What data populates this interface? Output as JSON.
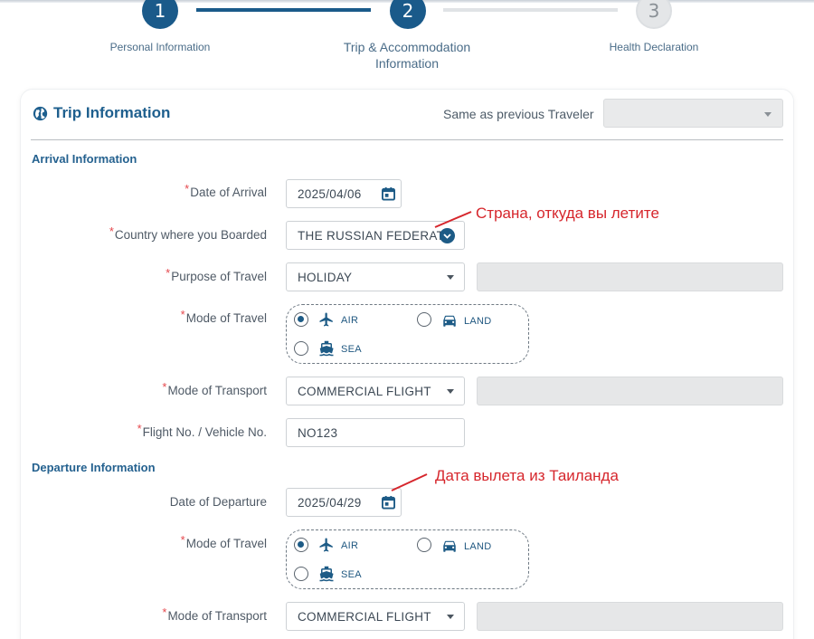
{
  "stepper": {
    "steps": [
      {
        "number": "1",
        "label": "Personal Information",
        "state": "done"
      },
      {
        "number": "2",
        "label": "Trip & Accommodation Information",
        "state": "active"
      },
      {
        "number": "3",
        "label": "Health Declaration",
        "state": "todo"
      }
    ]
  },
  "trip": {
    "title": "Trip Information",
    "same_as_previous_label": "Same as previous Traveler",
    "same_as_previous_value": ""
  },
  "arrival": {
    "section_title": "Arrival Information",
    "date_label": "Date of Arrival",
    "date_value": "2025/04/06",
    "country_label": "Country where you Boarded",
    "country_value": "THE RUSSIAN FEDERAT",
    "purpose_label": "Purpose of Travel",
    "purpose_value": "HOLIDAY",
    "mode_label": "Mode of Travel",
    "mode_options": [
      "AIR",
      "LAND",
      "SEA"
    ],
    "mode_selected": "AIR",
    "transport_label": "Mode of Transport",
    "transport_value": "COMMERCIAL FLIGHT",
    "flight_label": "Flight No. / Vehicle No.",
    "flight_value": "NO123"
  },
  "departure": {
    "section_title": "Departure Information",
    "date_label": "Date of Departure",
    "date_value": "2025/04/29",
    "mode_label": "Mode of Travel",
    "mode_options": [
      "AIR",
      "LAND",
      "SEA"
    ],
    "mode_selected": "AIR",
    "transport_label": "Mode of Transport",
    "transport_value": "COMMERCIAL FLIGHT"
  },
  "required_marker": "*",
  "annotations": {
    "country_note": "Страна, откуда вы летите",
    "departure_note": "Дата вылета из Таиланда"
  },
  "colors": {
    "primary": "#1a5a8a",
    "annotation": "#d6262c",
    "required": "#e5484d"
  },
  "icons": {
    "trip_title": "globe-icon",
    "date": "calendar-icon",
    "air": "airplane-icon",
    "land": "car-icon",
    "sea": "ship-icon"
  }
}
